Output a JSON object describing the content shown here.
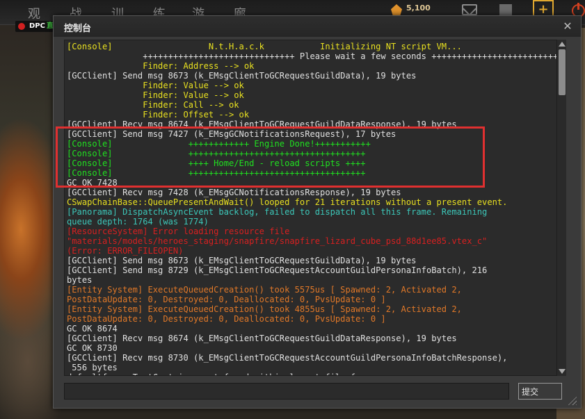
{
  "nav": {
    "watch": "观 战",
    "learn": "训 练",
    "arcade": "游 廊"
  },
  "top_right": {
    "shards": "5,100",
    "shard_icon": "shard-icon",
    "mail_icon": "mail-icon",
    "flag_icon": "flag-icon",
    "plus_icon": "plus-icon",
    "power_icon": "power-icon"
  },
  "badge": {
    "label": "DPC",
    "extra": "直"
  },
  "console": {
    "title": "控制台",
    "close": "✕",
    "submit_label": "提交",
    "input_value": "",
    "highlight_color": "#e03030",
    "lines": [
      {
        "c": "c-yellow",
        "t": "[Console]                   N.t.H.a.c.k           Initializing NT script VM..."
      },
      {
        "c": "c-white",
        "t": "               ++++++++++++++++++++++++++++++ Please wait a few seconds ++++++++++++++++++++++++++++++++"
      },
      {
        "c": "c-yellow",
        "t": "               Finder: Address --> ok"
      },
      {
        "c": "c-white",
        "t": "[GCClient] Send msg 8673 (k_EMsgClientToGCRequestGuildData), 19 bytes"
      },
      {
        "c": "c-yellow",
        "t": "               Finder: Value --> ok"
      },
      {
        "c": "c-yellow",
        "t": "               Finder: Value --> ok"
      },
      {
        "c": "c-yellow",
        "t": "               Finder: Call --> ok"
      },
      {
        "c": "c-yellow",
        "t": "               Finder: Offset --> ok"
      },
      {
        "c": "c-white",
        "t": "[GCClient] Recv msg 8674 (k_EMsgClientToGCRequestGuildDataResponse), 19 bytes"
      },
      {
        "c": "c-white",
        "t": "[GCClient] Send msg 7427 (k_EMsgGCNotificationsRequest), 17 bytes"
      },
      {
        "c": "c-green",
        "t": "[Console]               ++++++++++++ Engine Done!+++++++++++"
      },
      {
        "c": "c-green",
        "t": "[Console]               +++++++++++++++++++++++++++++++++++"
      },
      {
        "c": "c-green",
        "t": "[Console]               ++++ Home/End - reload scripts ++++"
      },
      {
        "c": "c-green",
        "t": "[Console]               +++++++++++++++++++++++++++++++++++"
      },
      {
        "c": "c-white",
        "t": "GC OK 7428"
      },
      {
        "c": "c-white",
        "t": "[GCClient] Recv msg 7428 (k_EMsgGCNotificationsResponse), 19 bytes"
      },
      {
        "c": "c-yellow",
        "t": "CSwapChainBase::QueuePresentAndWait() looped for 21 iterations without a present event."
      },
      {
        "c": "c-teal",
        "t": "[Panorama] DispatchAsyncEvent backlog, failed to dispatch all this frame. Remaining"
      },
      {
        "c": "c-teal",
        "t": "queue depth: 1764 (was 1774)"
      },
      {
        "c": "c-red",
        "t": "[ResourceSystem] Error loading resource file"
      },
      {
        "c": "c-red",
        "t": "\"materials/models/heroes_staging/snapfire/snapfire_lizard_cube_psd_88d1ee85.vtex_c\""
      },
      {
        "c": "c-red",
        "t": "(Error: ERROR_FILEOPEN)"
      },
      {
        "c": "c-white",
        "t": "[GCClient] Send msg 8673 (k_EMsgClientToGCRequestGuildData), 19 bytes"
      },
      {
        "c": "c-white",
        "t": "[GCClient] Send msg 8729 (k_EMsgClientToGCRequestAccountGuildPersonaInfoBatch), 216"
      },
      {
        "c": "c-white",
        "t": "bytes"
      },
      {
        "c": "c-orange",
        "t": "[Entity System] ExecuteQueuedCreation() took 5575us [ Spawned: 2, Activated 2,"
      },
      {
        "c": "c-orange",
        "t": "PostDataUpdate: 0, Destroyed: 0, Deallocated: 0, PvsUpdate: 0 ]"
      },
      {
        "c": "c-orange",
        "t": "[Entity System] ExecuteQueuedCreation() took 4855us [ Spawned: 2, Activated 2,"
      },
      {
        "c": "c-orange",
        "t": "PostDataUpdate: 0, Destroyed: 0, Deallocated: 0, PvsUpdate: 0 ]"
      },
      {
        "c": "c-white",
        "t": "GC OK 8674"
      },
      {
        "c": "c-white",
        "t": "[GCClient] Recv msg 8674 (k_EMsgClientToGCRequestGuildDataResponse), 19 bytes"
      },
      {
        "c": "c-white",
        "t": "GC OK 8730"
      },
      {
        "c": "c-white",
        "t": "[GCClient] Recv msg 8730 (k_EMsgClientToGCRequestAccountGuildPersonaInfoBatchResponse),"
      },
      {
        "c": "c-white",
        "t": " 556 bytes"
      },
      {
        "c": "c-white",
        "t": "defaultfocus TestContainer not found within layout file for"
      }
    ]
  }
}
